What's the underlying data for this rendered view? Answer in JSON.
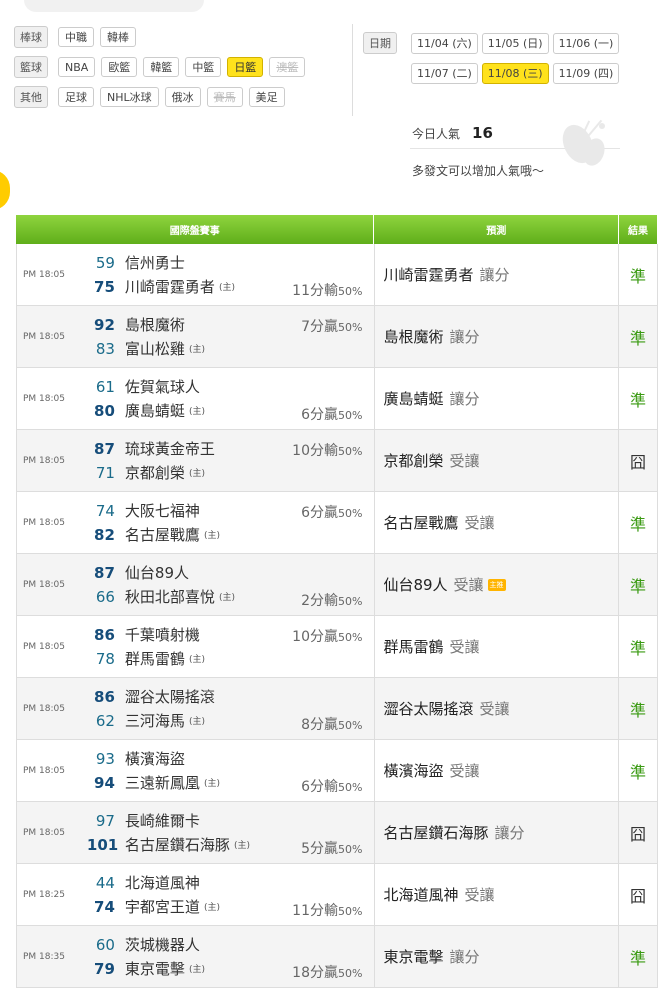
{
  "filters": {
    "baseball": {
      "label": "棒球",
      "items": [
        {
          "text": "中職"
        },
        {
          "text": "韓棒"
        }
      ]
    },
    "basketball": {
      "label": "籃球",
      "items": [
        {
          "text": "NBA"
        },
        {
          "text": "歐籃"
        },
        {
          "text": "韓籃"
        },
        {
          "text": "中籃"
        },
        {
          "text": "日籃",
          "state": "active"
        },
        {
          "text": "澳籃",
          "state": "disabled"
        }
      ]
    },
    "other": {
      "label": "其他",
      "items": [
        {
          "text": "足球"
        },
        {
          "text": "NHL冰球"
        },
        {
          "text": "俄冰"
        },
        {
          "text": "賽馬",
          "state": "disabled"
        },
        {
          "text": "美足"
        }
      ]
    }
  },
  "dates": {
    "label": "日期",
    "row1": [
      {
        "text": "11/04 (六)"
      },
      {
        "text": "11/05 (日)"
      },
      {
        "text": "11/06 (一)"
      }
    ],
    "row2": [
      {
        "text": "11/07 (二)"
      },
      {
        "text": "11/08 (三)",
        "state": "active"
      },
      {
        "text": "11/09 (四)"
      }
    ]
  },
  "popularity": {
    "label": "今日人氣",
    "count": "16",
    "hint": "多發文可以增加人氣哦～"
  },
  "table": {
    "headers": {
      "event": "國際盤賽事",
      "prediction": "預測",
      "result": "結果"
    },
    "rows": [
      {
        "time": "PM 18:05",
        "away": {
          "score": "59",
          "name": "信州勇士"
        },
        "home": {
          "score": "75",
          "name": "川崎雷霆勇者"
        },
        "win": "home",
        "home_tag": "(主)",
        "line": {
          "val": "11分輸",
          "pct": "50%",
          "pos": "bot"
        },
        "pred": {
          "team": "川崎雷霆勇者",
          "kind": "讓分"
        },
        "result": "準",
        "res_type": "win"
      },
      {
        "time": "PM 18:05",
        "away": {
          "score": "92",
          "name": "島根魔術"
        },
        "home": {
          "score": "83",
          "name": "富山松雞"
        },
        "win": "away",
        "home_tag": "(主)",
        "line": {
          "val": "7分贏",
          "pct": "50%",
          "pos": "top"
        },
        "pred": {
          "team": "島根魔術",
          "kind": "讓分"
        },
        "result": "準",
        "res_type": "win"
      },
      {
        "time": "PM 18:05",
        "away": {
          "score": "61",
          "name": "佐賀氣球人"
        },
        "home": {
          "score": "80",
          "name": "廣島蜻蜓"
        },
        "win": "home",
        "home_tag": "(主)",
        "line": {
          "val": "6分贏",
          "pct": "50%",
          "pos": "bot"
        },
        "pred": {
          "team": "廣島蜻蜓",
          "kind": "讓分"
        },
        "result": "準",
        "res_type": "win"
      },
      {
        "time": "PM 18:05",
        "away": {
          "score": "87",
          "name": "琉球黃金帝王"
        },
        "home": {
          "score": "71",
          "name": "京都創榮"
        },
        "win": "away",
        "home_tag": "(主)",
        "line": {
          "val": "10分輸",
          "pct": "50%",
          "pos": "top"
        },
        "pred": {
          "team": "京都創榮",
          "kind": "受讓"
        },
        "result": "囧",
        "res_type": "lose"
      },
      {
        "time": "PM 18:05",
        "away": {
          "score": "74",
          "name": "大阪七福神"
        },
        "home": {
          "score": "82",
          "name": "名古屋戰鷹"
        },
        "win": "home",
        "home_tag": "(主)",
        "line": {
          "val": "6分贏",
          "pct": "50%",
          "pos": "top"
        },
        "pred": {
          "team": "名古屋戰鷹",
          "kind": "受讓"
        },
        "result": "準",
        "res_type": "win"
      },
      {
        "time": "PM 18:05",
        "away": {
          "score": "87",
          "name": "仙台89人"
        },
        "home": {
          "score": "66",
          "name": "秋田北部喜悅"
        },
        "win": "away",
        "home_tag": "(主)",
        "line": {
          "val": "2分輸",
          "pct": "50%",
          "pos": "bot"
        },
        "pred": {
          "team": "仙台89人",
          "kind": "受讓",
          "badge": "主推"
        },
        "result": "準",
        "res_type": "win"
      },
      {
        "time": "PM 18:05",
        "away": {
          "score": "86",
          "name": "千葉噴射機"
        },
        "home": {
          "score": "78",
          "name": "群馬雷鶴"
        },
        "win": "away",
        "home_tag": "(主)",
        "line": {
          "val": "10分贏",
          "pct": "50%",
          "pos": "top"
        },
        "pred": {
          "team": "群馬雷鶴",
          "kind": "受讓"
        },
        "result": "準",
        "res_type": "win"
      },
      {
        "time": "PM 18:05",
        "away": {
          "score": "86",
          "name": "澀谷太陽搖滾"
        },
        "home": {
          "score": "62",
          "name": "三河海馬"
        },
        "win": "away",
        "home_tag": "(主)",
        "line": {
          "val": "8分贏",
          "pct": "50%",
          "pos": "bot"
        },
        "pred": {
          "team": "澀谷太陽搖滾",
          "kind": "受讓"
        },
        "result": "準",
        "res_type": "win"
      },
      {
        "time": "PM 18:05",
        "away": {
          "score": "93",
          "name": "橫濱海盜"
        },
        "home": {
          "score": "94",
          "name": "三遠新鳳凰"
        },
        "win": "home",
        "home_tag": "(主)",
        "line": {
          "val": "6分輸",
          "pct": "50%",
          "pos": "bot"
        },
        "pred": {
          "team": "橫濱海盜",
          "kind": "受讓"
        },
        "result": "準",
        "res_type": "win"
      },
      {
        "time": "PM 18:05",
        "away": {
          "score": "97",
          "name": "長崎維爾卡"
        },
        "home": {
          "score": "101",
          "name": "名古屋鑽石海豚"
        },
        "win": "home",
        "home_tag": "(主)",
        "line": {
          "val": "5分贏",
          "pct": "50%",
          "pos": "bot"
        },
        "pred": {
          "team": "名古屋鑽石海豚",
          "kind": "讓分"
        },
        "result": "囧",
        "res_type": "lose"
      },
      {
        "time": "PM 18:25",
        "away": {
          "score": "44",
          "name": "北海道風神"
        },
        "home": {
          "score": "74",
          "name": "宇都宮王道"
        },
        "win": "home",
        "home_tag": "(主)",
        "line": {
          "val": "11分輸",
          "pct": "50%",
          "pos": "bot"
        },
        "pred": {
          "team": "北海道風神",
          "kind": "受讓"
        },
        "result": "囧",
        "res_type": "lose"
      },
      {
        "time": "PM 18:35",
        "away": {
          "score": "60",
          "name": "茨城機器人"
        },
        "home": {
          "score": "79",
          "name": "東京電擊"
        },
        "win": "home",
        "home_tag": "(主)",
        "line": {
          "val": "18分贏",
          "pct": "50%",
          "pos": "bot"
        },
        "pred": {
          "team": "東京電擊",
          "kind": "讓分"
        },
        "result": "準",
        "res_type": "win"
      }
    ]
  }
}
